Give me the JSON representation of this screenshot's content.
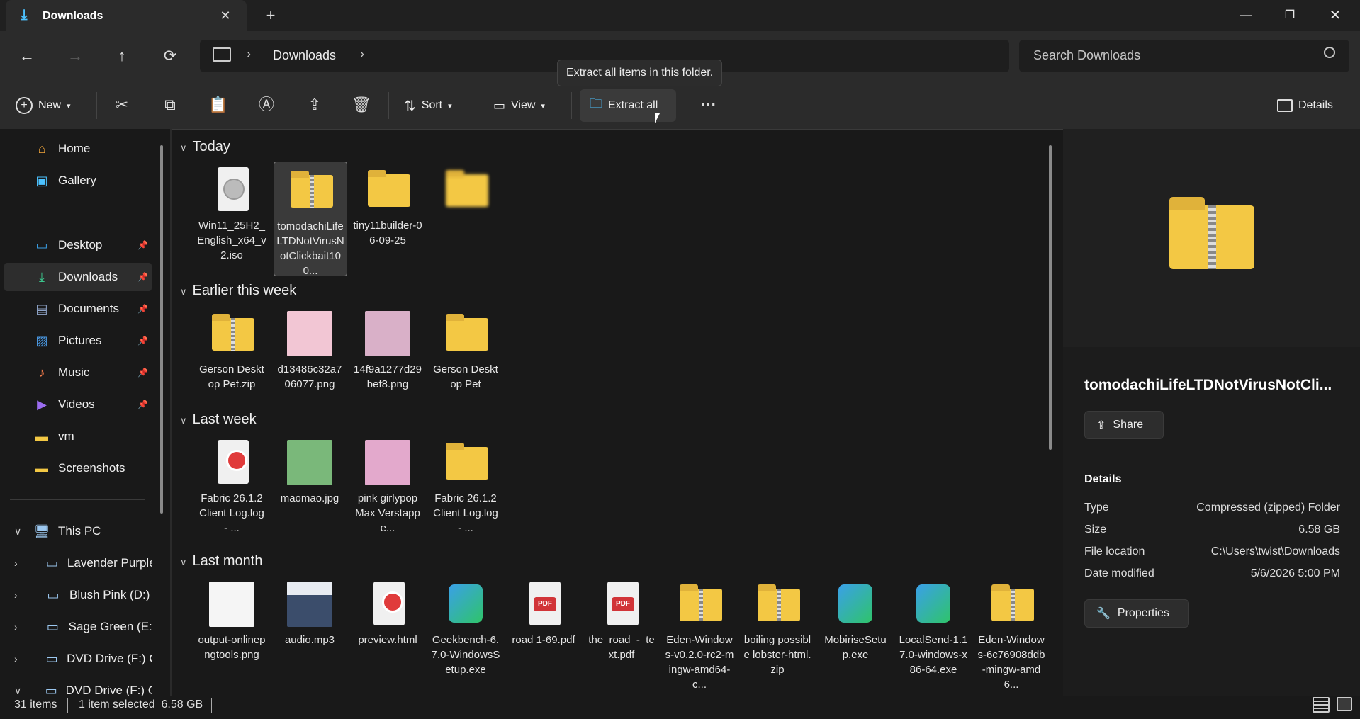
{
  "window": {
    "tab_title": "Downloads",
    "tab_close": "✕",
    "new_tab": "+",
    "minimize": "—",
    "restore": "❐",
    "close": "✕"
  },
  "nav": {
    "back": "←",
    "forward": "→",
    "up": "↑",
    "refresh": "⟳",
    "breadcrumb": [
      "Downloads"
    ],
    "search_placeholder": "Search Downloads"
  },
  "toolbar": {
    "new_label": "New",
    "sort_label": "Sort",
    "view_label": "View",
    "extract_label": "Extract all",
    "more_label": "···",
    "details_label": "Details",
    "tooltip": "Extract all items in this folder."
  },
  "sidebar": {
    "quick": [
      {
        "label": "Home",
        "icon": "home-icon"
      },
      {
        "label": "Gallery",
        "icon": "gallery-icon"
      }
    ],
    "pinned": [
      {
        "label": "Desktop",
        "icon": "desktop-icon"
      },
      {
        "label": "Downloads",
        "icon": "downloads-icon"
      },
      {
        "label": "Documents",
        "icon": "documents-icon"
      },
      {
        "label": "Pictures",
        "icon": "pictures-icon"
      },
      {
        "label": "Music",
        "icon": "music-icon"
      },
      {
        "label": "Videos",
        "icon": "videos-icon"
      },
      {
        "label": "vm",
        "icon": "folder-icon"
      },
      {
        "label": "Screenshots",
        "icon": "folder-icon"
      }
    ],
    "tree": [
      {
        "label": "This PC"
      },
      {
        "label": "Lavender Purple ("
      },
      {
        "label": "Blush Pink (D:)"
      },
      {
        "label": "Sage Green (E:)"
      },
      {
        "label": "DVD Drive (F:) CC"
      },
      {
        "label": "DVD Drive (F:) CCC"
      }
    ]
  },
  "groups": [
    {
      "title": "Today",
      "items": [
        {
          "name": "Win11_25H2_English_x64_v2.iso",
          "icon": "iso-icon"
        },
        {
          "name": "tomodachiLifeLTDNotVirusNotClickbait100...",
          "icon": "zip-folder-icon"
        },
        {
          "name": "tiny11builder-06-09-25",
          "icon": "folder-icon"
        },
        {
          "name": "",
          "icon": "folder-icon"
        }
      ]
    },
    {
      "title": "Earlier this week",
      "items": [
        {
          "name": "Gerson Desktop Pet.zip",
          "icon": "zip-folder-icon"
        },
        {
          "name": "d13486c32a706077.png",
          "icon": "image-icon"
        },
        {
          "name": "14f9a1277d29bef8.png",
          "icon": "image-icon"
        },
        {
          "name": "Gerson Desktop Pet",
          "icon": "folder-icon"
        }
      ]
    },
    {
      "title": "Last week",
      "items": [
        {
          "name": "Fabric 26.1.2 Client Log.log - ...",
          "icon": "vivaldi-doc-icon"
        },
        {
          "name": "maomao.jpg",
          "icon": "image-icon"
        },
        {
          "name": "pink girlypop Max Verstappe...",
          "icon": "image-icon"
        },
        {
          "name": "Fabric 26.1.2 Client Log.log - ...",
          "icon": "folder-icon"
        }
      ]
    },
    {
      "title": "Last month",
      "items": [
        {
          "name": "output-onlinepngtools.png",
          "icon": "image-icon"
        },
        {
          "name": "audio.mp3",
          "icon": "audio-icon"
        },
        {
          "name": "preview.html",
          "icon": "vivaldi-doc-icon"
        },
        {
          "name": "Geekbench-6.7.0-WindowsSetup.exe",
          "icon": "installer-icon"
        },
        {
          "name": "road 1-69.pdf",
          "icon": "pdf-icon"
        },
        {
          "name": "the_road_-_text.pdf",
          "icon": "pdf-icon"
        },
        {
          "name": "Eden-Windows-v0.2.0-rc2-mingw-amd64-c...",
          "icon": "zip-folder-icon"
        },
        {
          "name": "boiling possible lobster-html.zip",
          "icon": "zip-folder-icon"
        },
        {
          "name": "MobiriseSetup.exe",
          "icon": "installer-icon"
        },
        {
          "name": "LocalSend-1.17.0-windows-x86-64.exe",
          "icon": "installer-icon"
        },
        {
          "name": "Eden-Windows-6c76908ddb-mingw-amd6...",
          "icon": "zip-folder-icon"
        }
      ]
    }
  ],
  "details": {
    "name": "tomodachiLifeLTDNotVirusNotCli...",
    "share_label": "Share",
    "section_title": "Details",
    "rows": [
      {
        "key": "Type",
        "value": "Compressed (zipped) Folder"
      },
      {
        "key": "Size",
        "value": "6.58 GB"
      },
      {
        "key": "File location",
        "value": "C:\\Users\\twist\\Downloads"
      },
      {
        "key": "Date modified",
        "value": "5/6/2026 5:00 PM"
      }
    ],
    "properties_label": "Properties"
  },
  "status": {
    "count": "31 items",
    "selection": "1 item selected  6.58 GB"
  },
  "colors": {
    "accent": "#4cc2ff",
    "folder": "#f3c844",
    "background": "#191919"
  }
}
